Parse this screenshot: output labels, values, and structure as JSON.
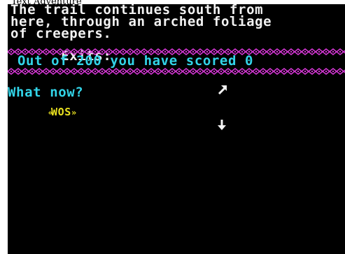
{
  "window": {
    "title": "Text Adventure"
  },
  "description": {
    "lines": [
      "The trail continues south from",
      "here, through an arched foliage",
      "of creepers."
    ],
    "exits_label": "Exits:",
    "exit_icons": [
      "northeast-arrow-icon",
      "south-arrow-icon"
    ]
  },
  "score": {
    "text": "Out of 200 you have scored 0"
  },
  "prompt": {
    "text": "What now?"
  },
  "input": {
    "value": "WOS",
    "left_chevrons": "«",
    "right_chevrons": "»"
  },
  "colors": {
    "background": "#000000",
    "description_text": "#f2f2f2",
    "score_text": "#32d4e8",
    "prompt_text": "#32d4e8",
    "input_text": "#e8e020",
    "border_pattern": "#d236d2"
  }
}
